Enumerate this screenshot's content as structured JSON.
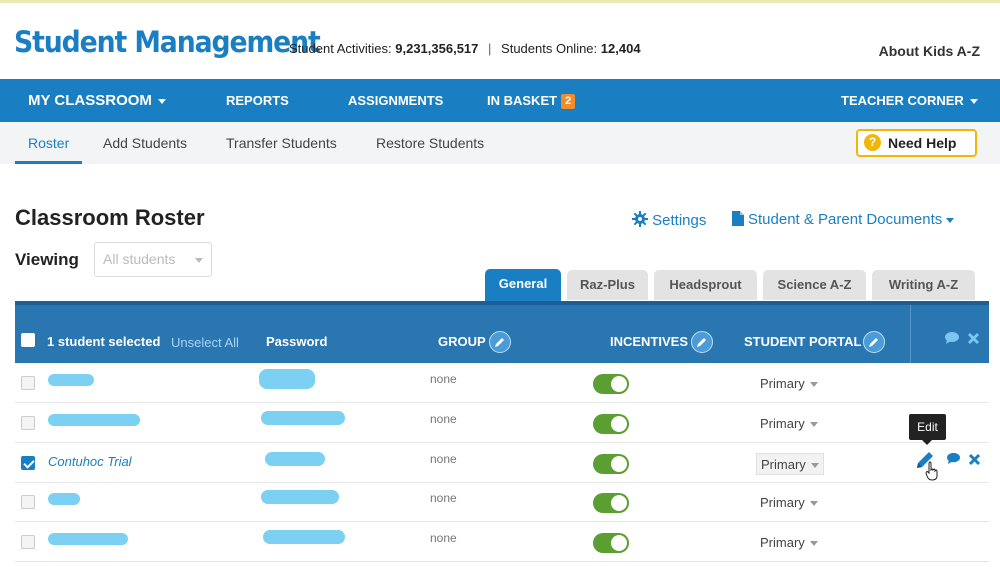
{
  "header": {
    "logo": "Student Management",
    "stats_activities_label": "Student Activities:",
    "stats_activities_value": "9,231,356,517",
    "stats_online_label": "Students Online:",
    "stats_online_value": "12,404",
    "about_link": "About Kids A-Z"
  },
  "nav": {
    "my_classroom": "MY CLASSROOM",
    "reports": "REPORTS",
    "assignments": "ASSIGNMENTS",
    "in_basket": "IN BASKET",
    "in_basket_count": "2",
    "teacher_corner": "TEACHER CORNER"
  },
  "subnav": {
    "tabs": [
      "Roster",
      "Add Students",
      "Transfer Students",
      "Restore Students"
    ],
    "help": "Need Help",
    "help_icon": "?"
  },
  "roster": {
    "title": "Classroom Roster",
    "settings": "Settings",
    "documents": "Student & Parent Documents",
    "viewing_label": "Viewing",
    "viewing_value": "All students",
    "product_tabs": [
      "General",
      "Raz-Plus",
      "Headsprout",
      "Science A-Z",
      "Writing A-Z"
    ]
  },
  "table": {
    "selected_label": "1 student selected",
    "unselect_all": "Unselect All",
    "col_password": "Password",
    "col_group": "GROUP",
    "col_incentives": "INCENTIVES",
    "col_portal": "STUDENT PORTAL",
    "rows": [
      {
        "name": "",
        "group": "none",
        "portal": "Primary",
        "checked": false,
        "incentives_on": true
      },
      {
        "name": "",
        "group": "none",
        "portal": "Primary",
        "checked": false,
        "incentives_on": true
      },
      {
        "name": "Contuhoc Trial",
        "group": "none",
        "portal": "Primary",
        "checked": true,
        "incentives_on": true
      },
      {
        "name": "",
        "group": "none",
        "portal": "Primary",
        "checked": false,
        "incentives_on": true
      },
      {
        "name": "",
        "group": "none",
        "portal": "Primary",
        "checked": false,
        "incentives_on": true
      }
    ]
  },
  "tooltip": "Edit",
  "colors": {
    "brand_blue": "#1a7fc2",
    "header_blue": "#2a76b0",
    "toggle_green": "#5b9e31",
    "badge_orange": "#f28c28",
    "help_yellow": "#f2b705"
  }
}
